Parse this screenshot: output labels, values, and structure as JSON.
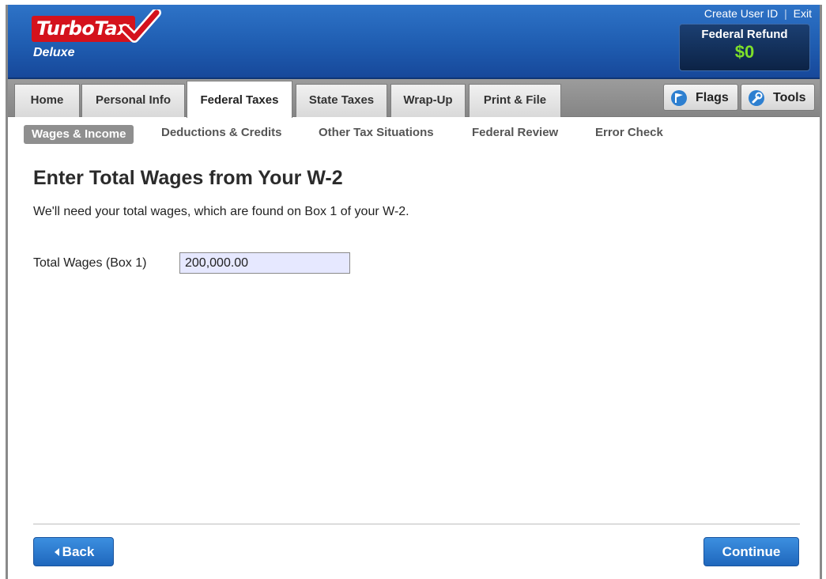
{
  "header": {
    "brand": "TurboTax",
    "edition": "Deluxe",
    "create_user_id": "Create User ID",
    "separator": "|",
    "exit": "Exit",
    "refund_label": "Federal Refund",
    "refund_amount": "$0"
  },
  "tabs": [
    {
      "label": "Home"
    },
    {
      "label": "Personal Info"
    },
    {
      "label": "Federal Taxes"
    },
    {
      "label": "State Taxes"
    },
    {
      "label": "Wrap-Up"
    },
    {
      "label": "Print & File"
    }
  ],
  "active_tab": "Federal Taxes",
  "tools": {
    "flags": "Flags",
    "tools": "Tools"
  },
  "subnav": [
    {
      "label": "Wages & Income"
    },
    {
      "label": "Deductions & Credits"
    },
    {
      "label": "Other Tax Situations"
    },
    {
      "label": "Federal Review"
    },
    {
      "label": "Error Check"
    }
  ],
  "active_subnav": "Wages & Income",
  "main": {
    "title": "Enter Total Wages from Your W-2",
    "description": "We'll need your total wages, which are found on Box 1 of your W-2.",
    "field_label": "Total Wages (Box 1)",
    "field_value": "200,000.00"
  },
  "footer": {
    "back_label": "Back",
    "continue_label": "Continue"
  },
  "colors": {
    "header_blue": "#1f5db1",
    "brand_red": "#d4121c",
    "refund_green": "#7ee02a",
    "button_blue": "#2a78d0",
    "input_bg": "#e6e8ff"
  }
}
